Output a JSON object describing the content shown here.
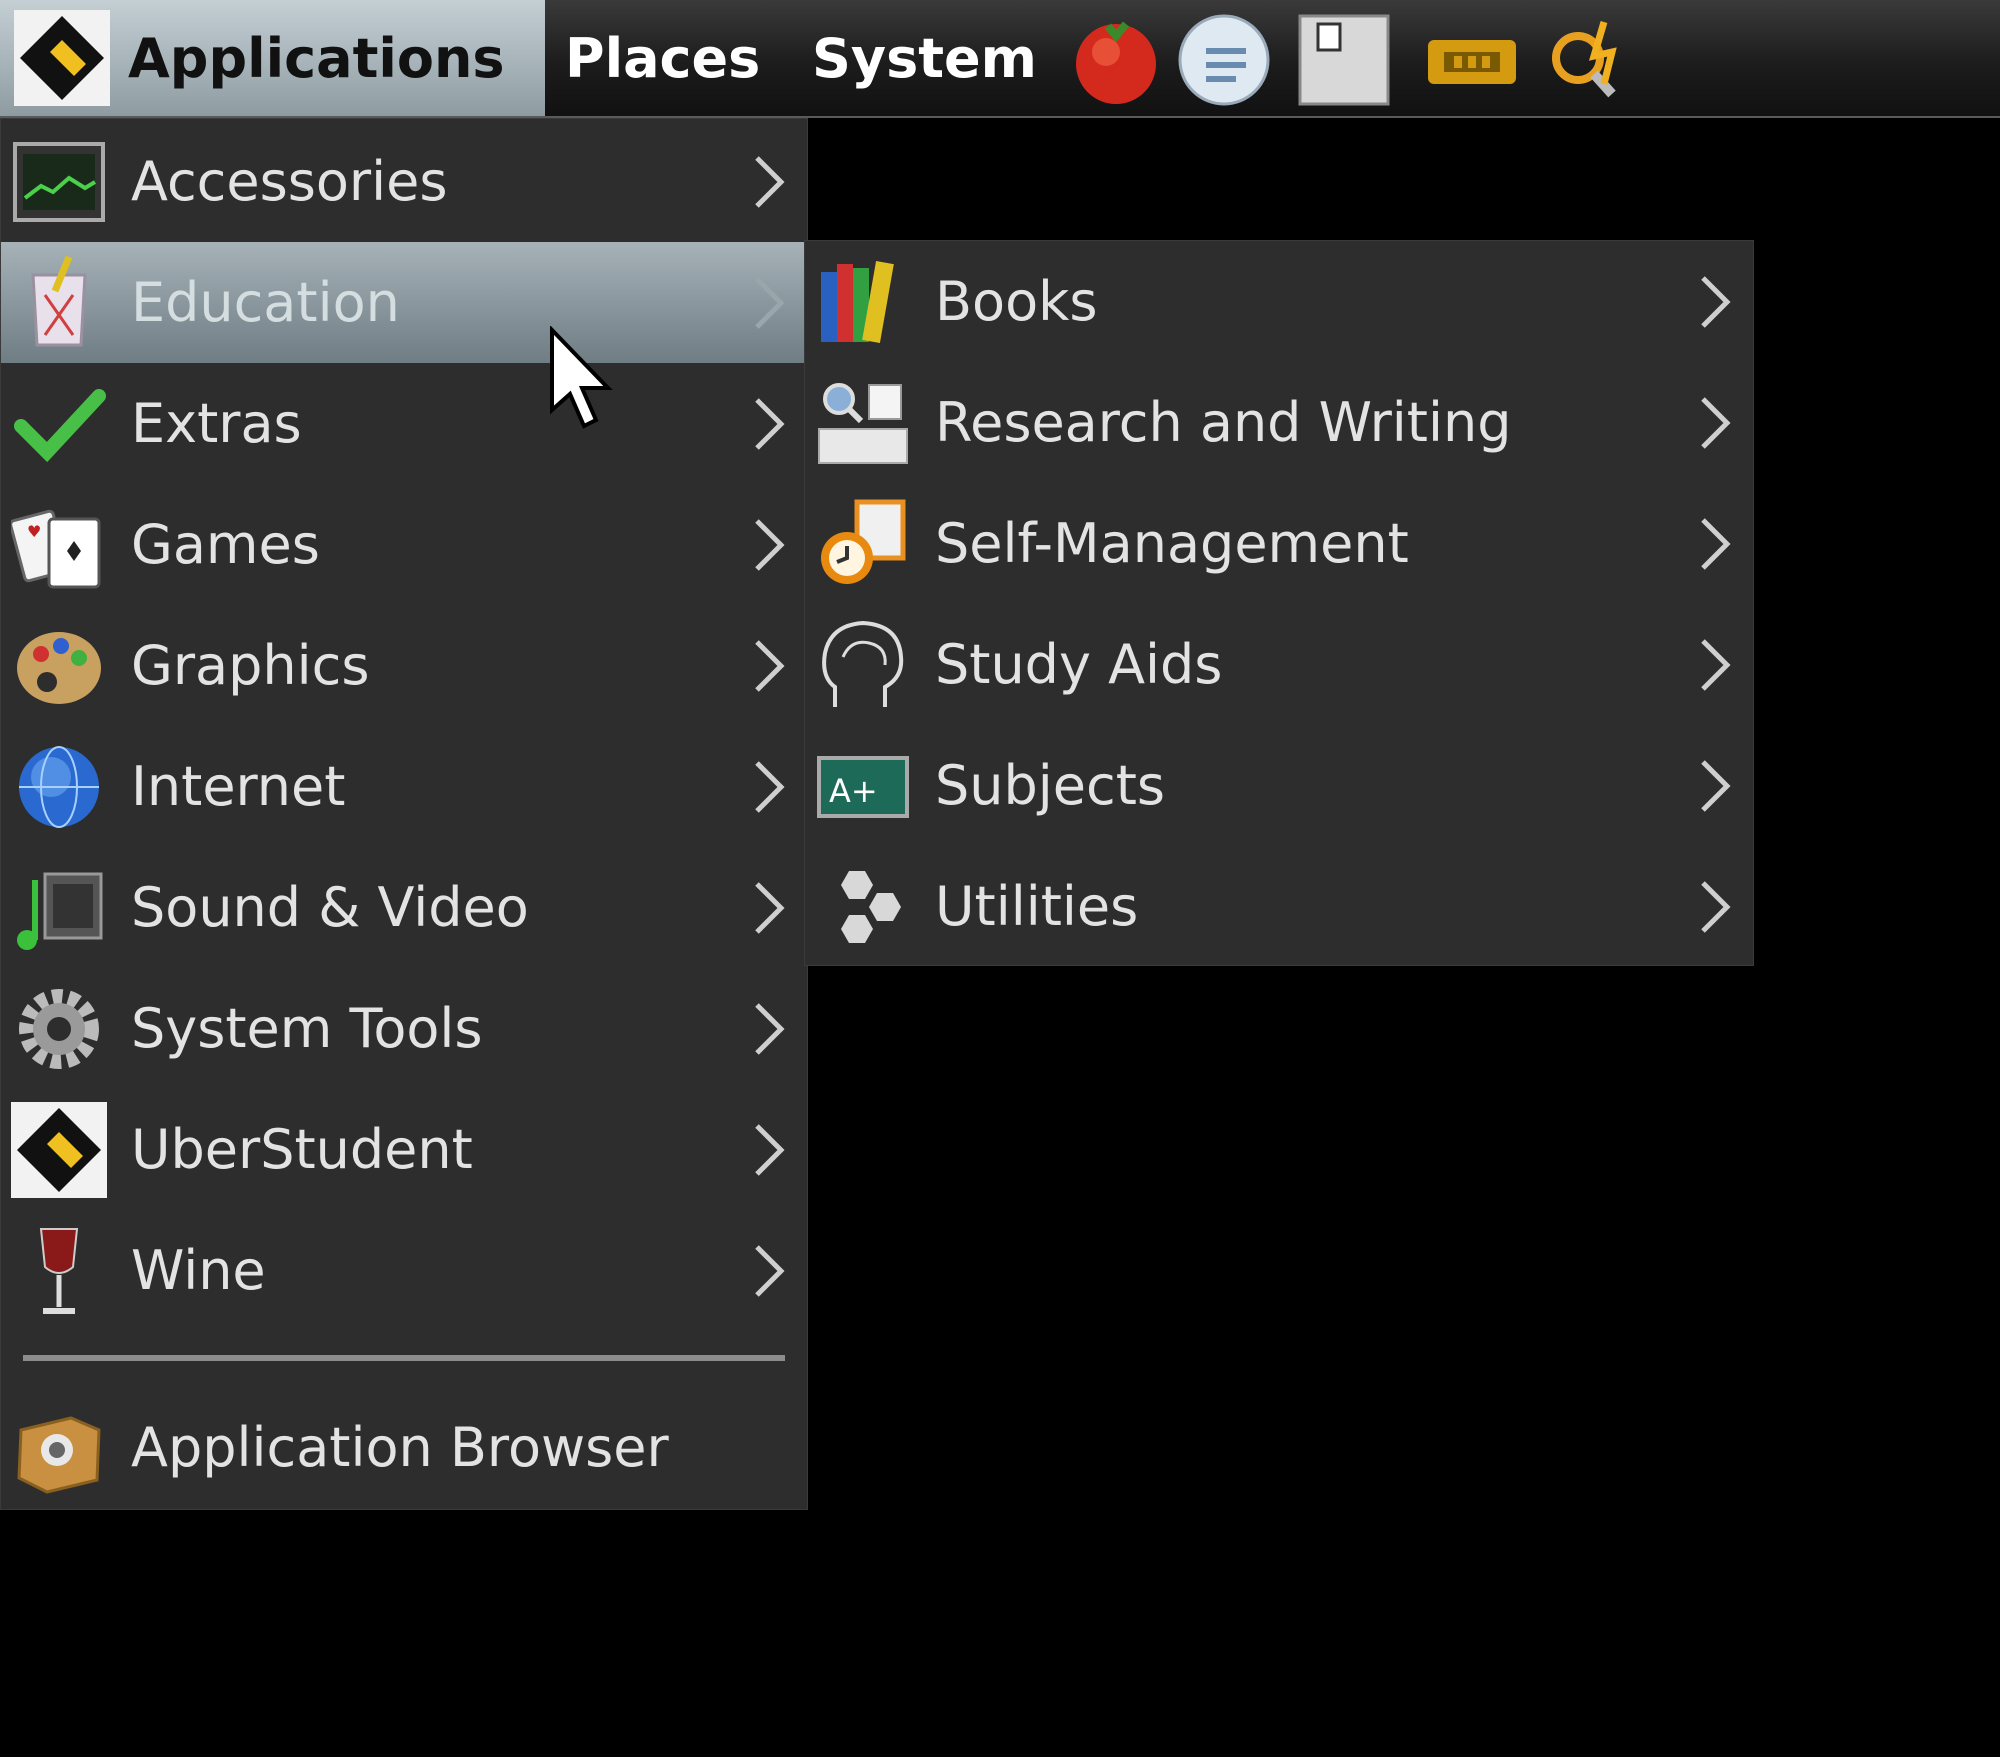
{
  "panel": {
    "applications_label": "Applications",
    "places_label": "Places",
    "system_label": "System",
    "tray_icons": [
      "tomato-timer-icon",
      "notes-app-icon",
      "document-icon",
      "keyboard-ram-icon",
      "search-power-icon"
    ]
  },
  "applications_menu": {
    "items": [
      {
        "label": "Accessories",
        "icon": "accessories-icon"
      },
      {
        "label": "Education",
        "icon": "education-icon",
        "highlighted": true
      },
      {
        "label": "Extras",
        "icon": "checkmark-icon"
      },
      {
        "label": "Games",
        "icon": "playing-cards-icon"
      },
      {
        "label": "Graphics",
        "icon": "paint-palette-icon"
      },
      {
        "label": "Internet",
        "icon": "globe-icon"
      },
      {
        "label": "Sound & Video",
        "icon": "music-film-icon"
      },
      {
        "label": "System Tools",
        "icon": "gear-icon"
      },
      {
        "label": "UberStudent",
        "icon": "uberstudent-logo-icon"
      },
      {
        "label": "Wine",
        "icon": "wine-glass-icon"
      }
    ],
    "footer_item": {
      "label": "Application Browser",
      "icon": "application-browser-icon"
    }
  },
  "education_submenu": {
    "items": [
      {
        "label": "Books",
        "icon": "books-icon"
      },
      {
        "label": "Research and Writing",
        "icon": "magnifier-keyboard-icon"
      },
      {
        "label": "Self-Management",
        "icon": "clock-clipboard-icon"
      },
      {
        "label": "Study Aids",
        "icon": "brain-head-icon"
      },
      {
        "label": "Subjects",
        "icon": "chalkboard-icon"
      },
      {
        "label": "Utilities",
        "icon": "hexagons-icon"
      }
    ]
  },
  "colors": {
    "menu_background": "#2d2d2d",
    "highlight": "#8e9ca2",
    "menu_text": "#e3e3e3",
    "desktop": "#000000"
  }
}
